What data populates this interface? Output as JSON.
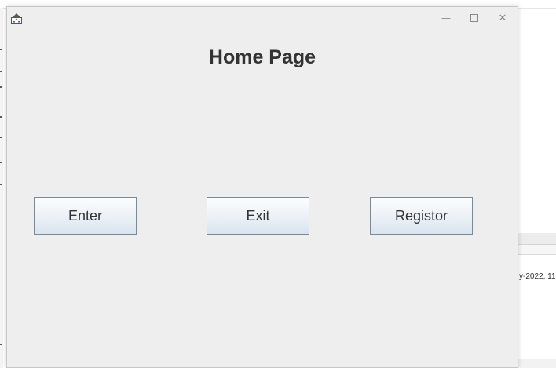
{
  "window": {
    "title": "",
    "icon": "java-app-icon",
    "controls": {
      "minimize_glyph": "—",
      "close_glyph": "✕"
    }
  },
  "main": {
    "heading": "Home Page",
    "buttons": [
      {
        "label": "Enter"
      },
      {
        "label": "Exit"
      },
      {
        "label": "Registor"
      }
    ]
  },
  "background": {
    "date_fragment": "y-2022, 11:"
  },
  "colors": {
    "frame_bg": "#eeeeee",
    "title_text": "#333333",
    "button_border": "#7a8a99",
    "button_gradient_bottom": "#d9e4ef"
  }
}
